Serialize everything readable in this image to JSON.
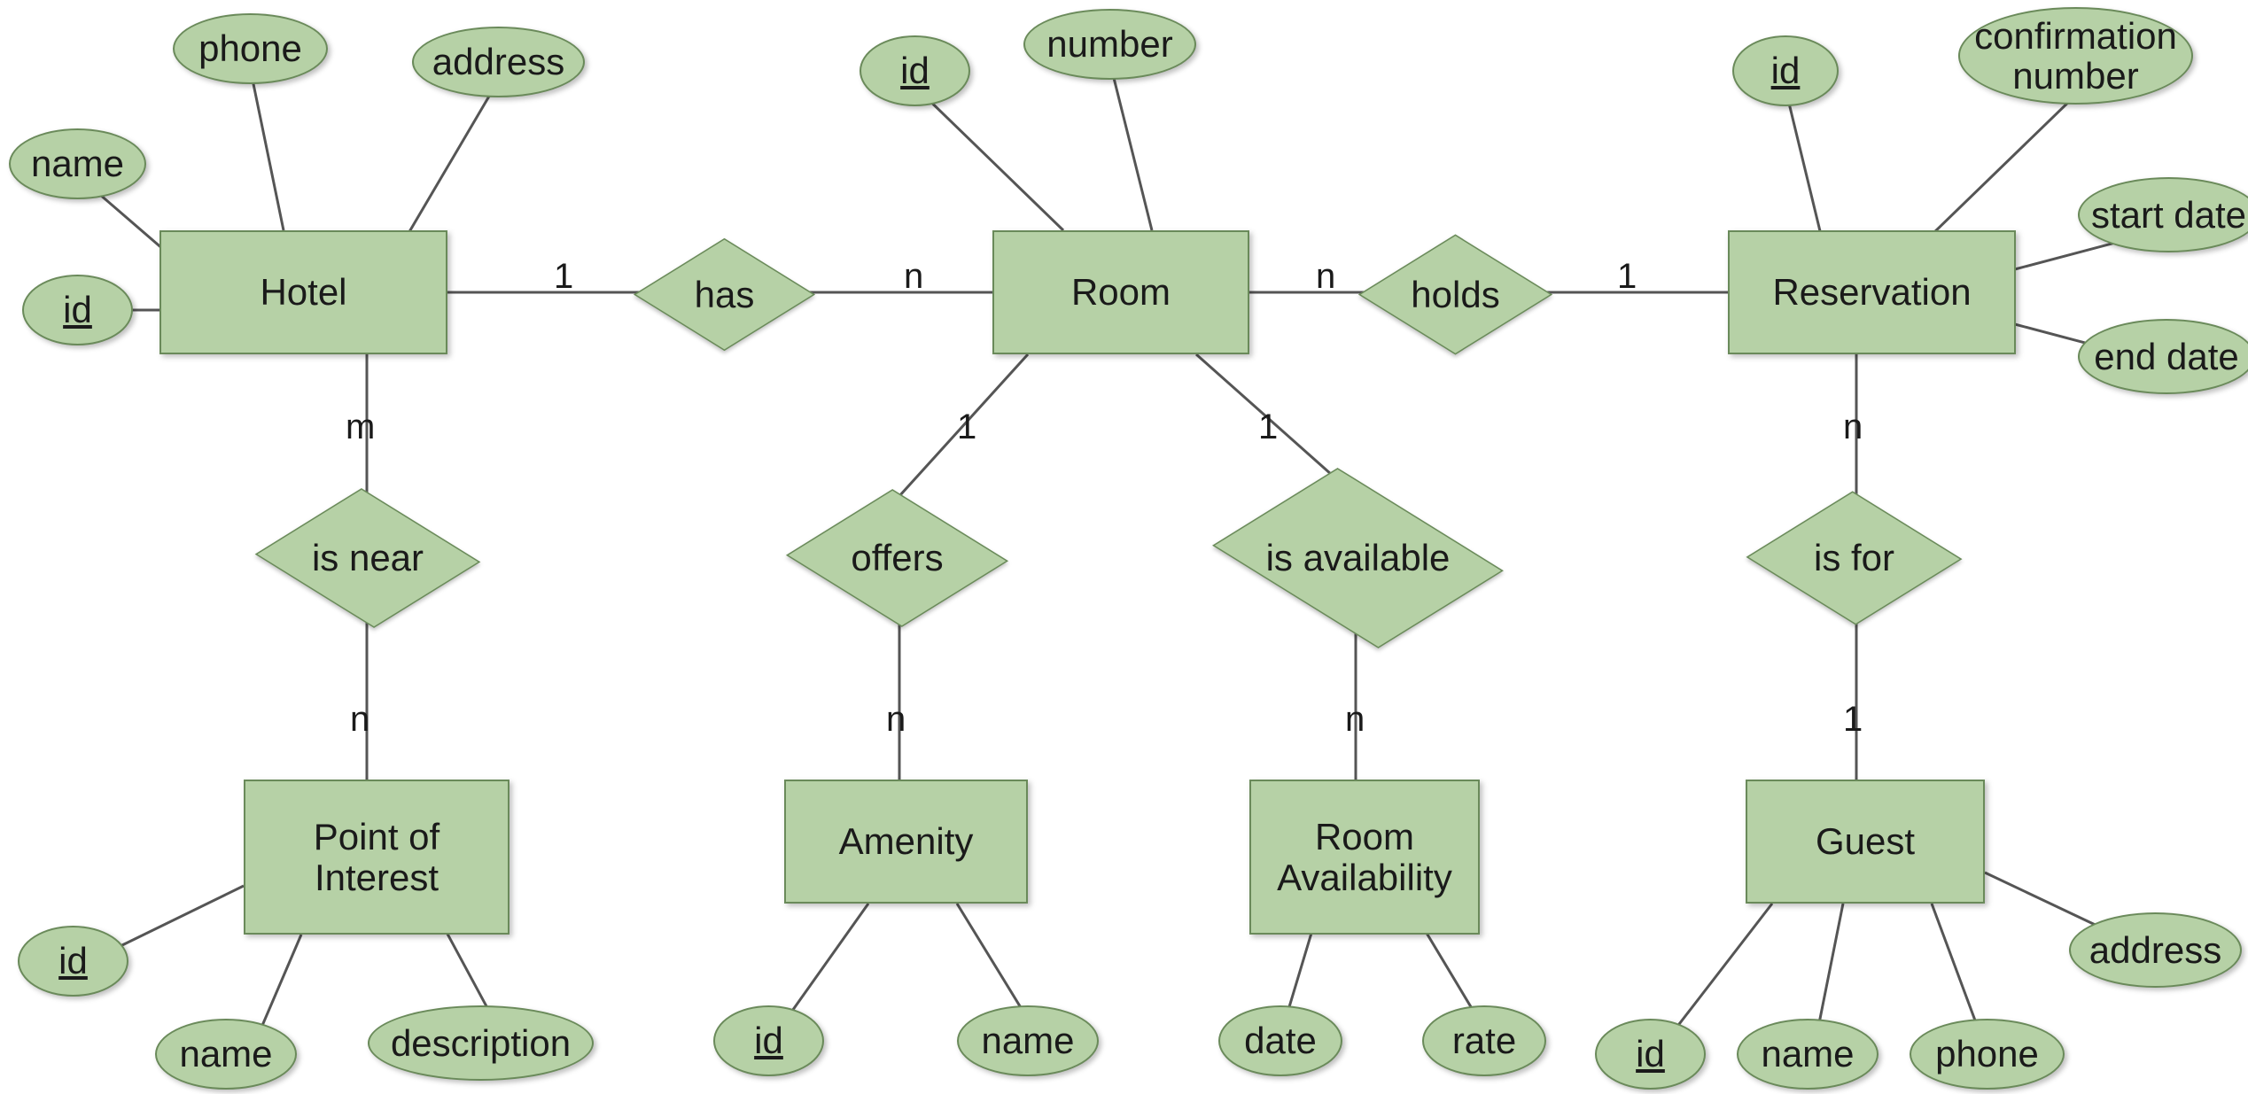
{
  "entities": {
    "hotel": {
      "label": "Hotel"
    },
    "room": {
      "label": "Room"
    },
    "reservation": {
      "label": "Reservation"
    },
    "poi": {
      "label": "Point of\nInterest"
    },
    "amenity": {
      "label": "Amenity"
    },
    "room_availability": {
      "label": "Room\nAvailability"
    },
    "guest": {
      "label": "Guest"
    }
  },
  "relationships": {
    "has": {
      "label": "has"
    },
    "holds": {
      "label": "holds"
    },
    "is_near": {
      "label": "is near"
    },
    "offers": {
      "label": "offers"
    },
    "is_available": {
      "label": "is available"
    },
    "is_for": {
      "label": "is for"
    }
  },
  "attributes": {
    "hotel_id": {
      "label": "id",
      "pk": true
    },
    "hotel_name": {
      "label": "name",
      "pk": false
    },
    "hotel_phone": {
      "label": "phone",
      "pk": false
    },
    "hotel_address": {
      "label": "address",
      "pk": false
    },
    "room_id": {
      "label": "id",
      "pk": true
    },
    "room_number": {
      "label": "number",
      "pk": false
    },
    "res_id": {
      "label": "id",
      "pk": true
    },
    "res_conf": {
      "label": "confirmation\nnumber",
      "pk": false
    },
    "res_start": {
      "label": "start date",
      "pk": false
    },
    "res_end": {
      "label": "end date",
      "pk": false
    },
    "poi_id": {
      "label": "id",
      "pk": true
    },
    "poi_name": {
      "label": "name",
      "pk": false
    },
    "poi_desc": {
      "label": "description",
      "pk": false
    },
    "amenity_id": {
      "label": "id",
      "pk": true
    },
    "amenity_name": {
      "label": "name",
      "pk": false
    },
    "avail_date": {
      "label": "date",
      "pk": false
    },
    "avail_rate": {
      "label": "rate",
      "pk": false
    },
    "guest_id": {
      "label": "id",
      "pk": true
    },
    "guest_name": {
      "label": "name",
      "pk": false
    },
    "guest_phone": {
      "label": "phone",
      "pk": false
    },
    "guest_address": {
      "label": "address",
      "pk": false
    }
  },
  "cardinalities": {
    "hotel_has": "1",
    "has_room": "n",
    "room_holds": "n",
    "holds_reservation": "1",
    "hotel_isnear": "m",
    "isnear_poi": "n",
    "room_offers": "1",
    "offers_amenity": "n",
    "room_isavail": "1",
    "isavail_avail": "n",
    "reservation_isfor": "n",
    "isfor_guest": "1"
  }
}
